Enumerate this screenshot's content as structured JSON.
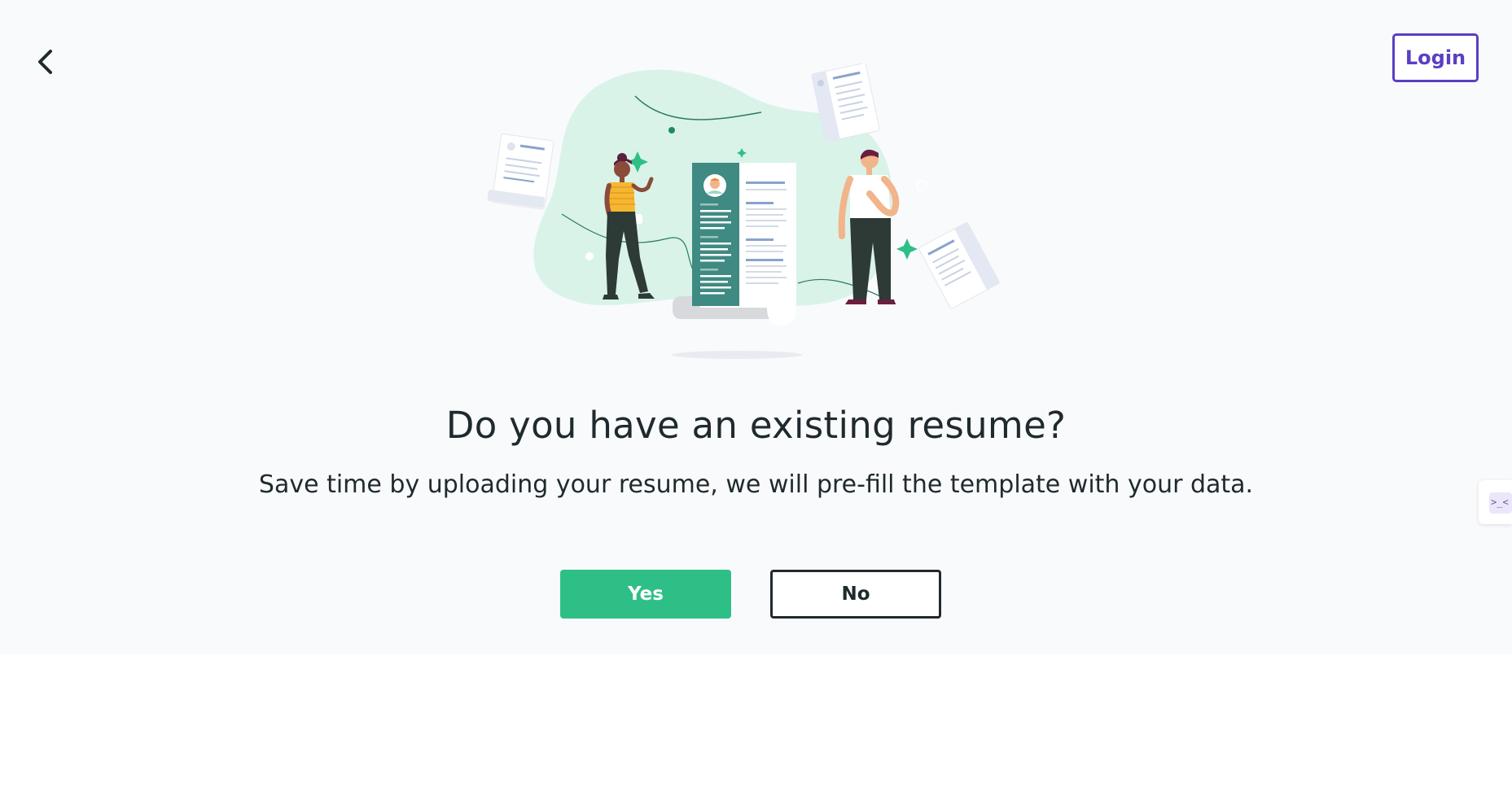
{
  "header": {
    "back_icon": "chevron-left-icon",
    "login_label": "Login"
  },
  "illustration": {
    "icon": "resume-illustration"
  },
  "main": {
    "headline": "Do you have an existing resume?",
    "subtitle": "Save time by uploading your resume, we will pre-fill the template with your data.",
    "yes_label": "Yes",
    "no_label": "No"
  },
  "side_widget": {
    "icon": "chat-widget-icon"
  },
  "colors": {
    "background": "#f9fafc",
    "primary_green": "#2ebf87",
    "login_purple": "#5b3fc4",
    "text_dark": "#1f2a2e",
    "blob_mint": "#d9f3e8",
    "resume_teal": "#3f8a82"
  }
}
